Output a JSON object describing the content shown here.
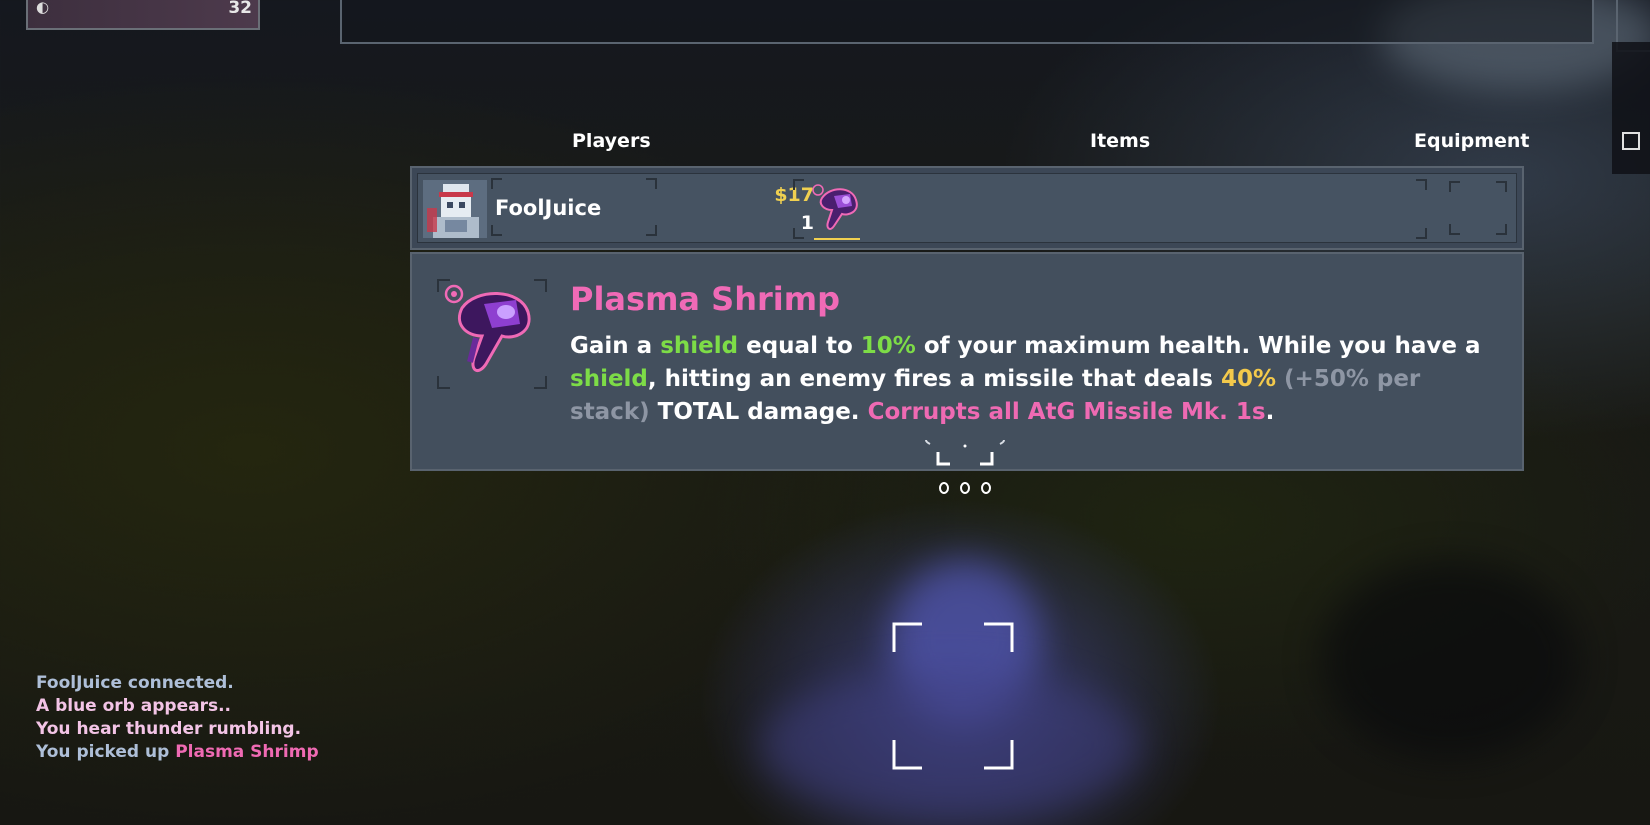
{
  "hud": {
    "top_counter": "32"
  },
  "scoreboard": {
    "headers": {
      "players": "Players",
      "items": "Items",
      "equipment": "Equipment"
    },
    "player": {
      "name": "FoolJuice",
      "money": "$17",
      "level": "1",
      "items": [
        "plasma-shrimp-icon"
      ]
    }
  },
  "tooltip": {
    "title": "Plasma Shrimp",
    "desc": {
      "t1": "Gain a ",
      "k1": "shield",
      "t2": " equal to ",
      "v1": "10%",
      "t3": " of your maximum health. While you have a ",
      "k2": "shield",
      "t4": ", hitting an enemy fires a missile that deals ",
      "v2": "40%",
      "stack": "(+50% per stack)",
      "t5": " TOTAL damage. ",
      "corrupt": "Corrupts all AtG Missile Mk. 1s",
      "t6": "."
    }
  },
  "chat_log": {
    "line1": "FoolJuice connected.",
    "line2": "A blue orb appears..",
    "line3": "You hear thunder rumbling.",
    "line4_prefix": "You picked up ",
    "line4_item": "Plasma Shrimp"
  },
  "colors": {
    "item_purple": "#f06ab6",
    "highlight_green": "#7ddc47",
    "highlight_yellow": "#f3c94b",
    "panel_bg": "#434f5d"
  }
}
